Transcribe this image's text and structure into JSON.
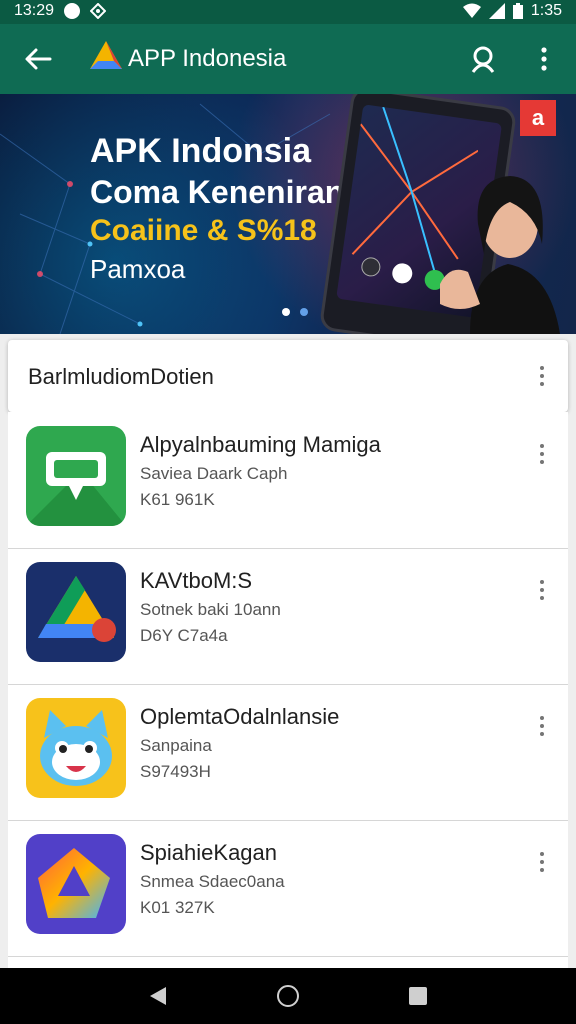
{
  "status_bar": {
    "time_left": "13:29",
    "time_right": "1:35"
  },
  "app_bar": {
    "title": "APP Indonesia"
  },
  "banner": {
    "line1": "APK Indonsia",
    "line2": "Coma Kenenirann",
    "line3": "Coaiine & S%18",
    "line4": "Pamxoa",
    "badge": "a"
  },
  "section": {
    "title": "BarlmludiomDotien"
  },
  "apps": [
    {
      "name": "Alpyalnbauming Mamiga",
      "subtitle": "Saviea Daark Caph",
      "meta": "K61 961K",
      "icon": "map-pin-icon"
    },
    {
      "name": "KAVtboM:S",
      "subtitle": "Sotnek baki 10ann",
      "meta": "D6Y C7a4a",
      "icon": "drive-triangle-icon"
    },
    {
      "name": "OplemtaOdalnlansie",
      "subtitle": "Sanpaina",
      "meta": "S97493H",
      "icon": "cat-face-icon"
    },
    {
      "name": "SpiahieKagan",
      "subtitle": "Snmea Sdaec0ana",
      "meta": "K01 327K",
      "icon": "gradient-triangle-icon"
    }
  ],
  "colors": {
    "app_bar": "#0f6b53",
    "status_bar": "#0b5a43",
    "accent_yellow": "#f6c21a"
  }
}
